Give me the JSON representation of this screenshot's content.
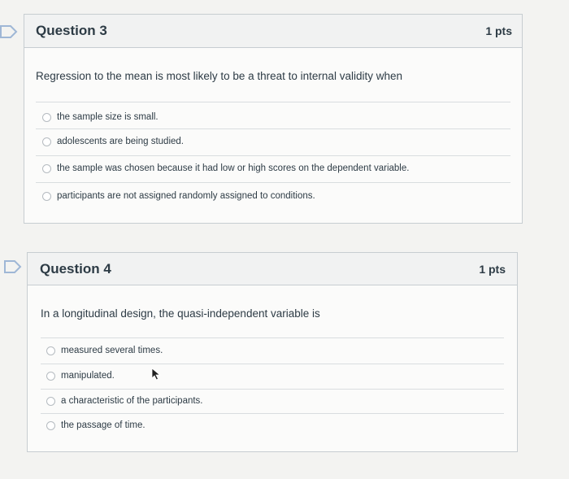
{
  "questions": [
    {
      "title": "Question 3",
      "points": "1 pts",
      "text": "Regression to the mean is most likely to be a threat to internal validity when",
      "answers": [
        "the sample size is small.",
        "adolescents are being studied.",
        "the sample was chosen because it had low or high scores on the dependent variable.",
        "participants are not assigned randomly assigned to conditions."
      ]
    },
    {
      "title": "Question 4",
      "points": "1 pts",
      "text": "In a longitudinal design, the quasi-independent variable is",
      "answers": [
        "measured several times.",
        "manipulated.",
        "a characteristic of the participants.",
        "the passage of time."
      ]
    }
  ],
  "colors": {
    "accent": "#2d3b45",
    "bookmark": "#9fb7d6",
    "border": "#c7cdd1"
  },
  "icons": {
    "bookmark": "bookmark-flag-icon",
    "cursor": "mouse-pointer-icon"
  }
}
